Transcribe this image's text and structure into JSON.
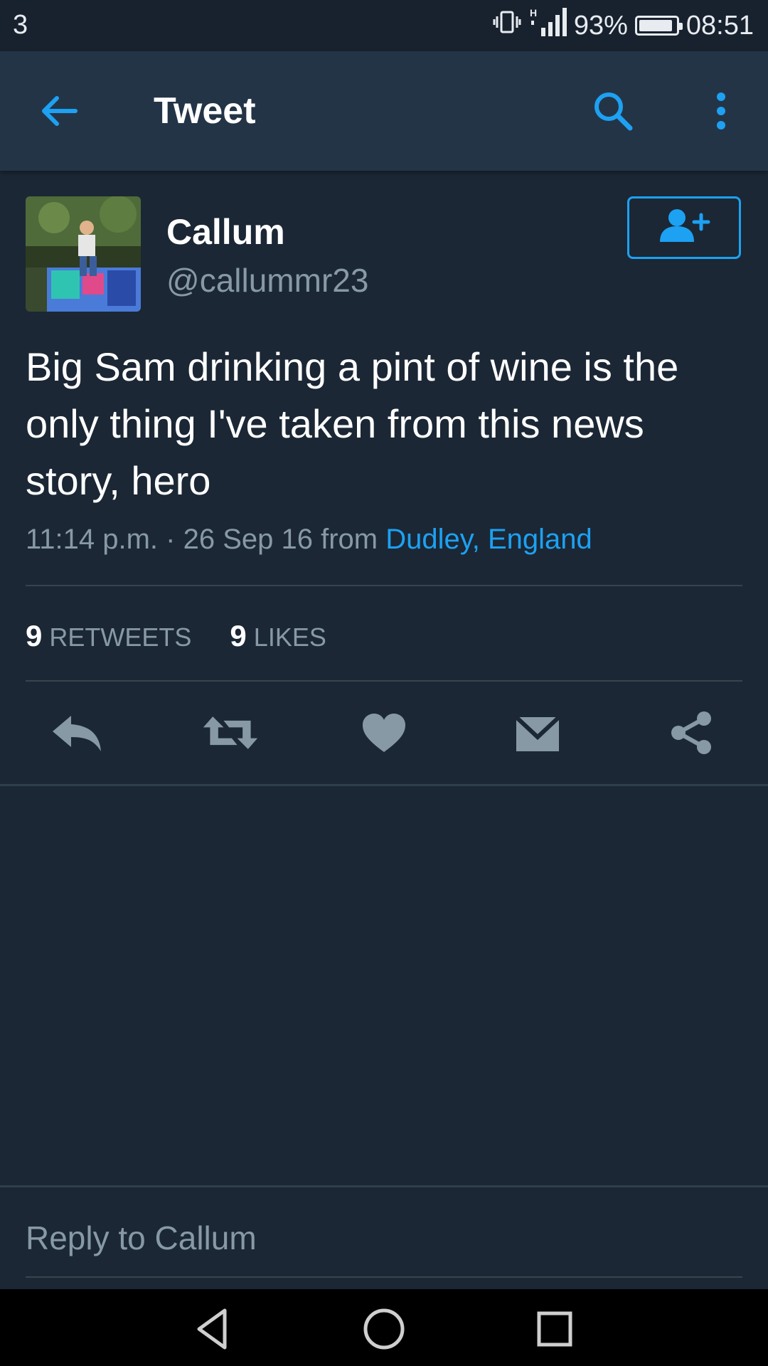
{
  "status_bar": {
    "notification_count": "3",
    "battery_percent": "93%",
    "battery_level": 0.93,
    "time": "08:51",
    "icons": [
      "vibrate-icon",
      "signal-h-icon",
      "battery-icon"
    ]
  },
  "app_bar": {
    "title": "Tweet",
    "icons": [
      "back-arrow-icon",
      "search-icon",
      "more-vert-icon"
    ]
  },
  "tweet": {
    "author_name": "Callum",
    "author_handle": "@callummr23",
    "text": "Big Sam drinking a pint of wine is the only thing I've taken from this news story, hero",
    "timestamp": "11:14 p.m. · 26 Sep 16",
    "from_label": "from",
    "location": "Dudley, England",
    "retweets_count": "9",
    "retweets_label": "RETWEETS",
    "likes_count": "9",
    "likes_label": "LIKES"
  },
  "actions": [
    "reply-icon",
    "retweet-icon",
    "like-icon",
    "direct-message-icon",
    "share-icon"
  ],
  "reply_box": {
    "placeholder": "Reply to Callum"
  },
  "colors": {
    "background": "#1b2735",
    "app_bar": "#243447",
    "accent": "#1da1f2",
    "secondary_text": "#8899a6",
    "icon_gray": "#8899a6"
  }
}
